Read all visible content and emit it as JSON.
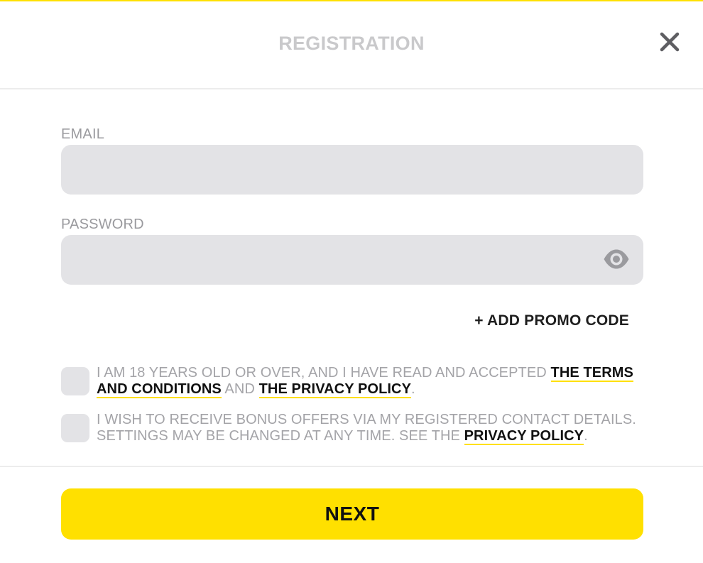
{
  "header": {
    "title": "REGISTRATION",
    "close_icon": "close-icon"
  },
  "form": {
    "email": {
      "label": "EMAIL",
      "value": "",
      "placeholder": ""
    },
    "password": {
      "label": "PASSWORD",
      "value": "",
      "placeholder": "",
      "toggle_icon": "eye-icon"
    },
    "promo_link": "+ ADD PROMO CODE"
  },
  "consents": {
    "age": {
      "checked": false,
      "text_before": "I AM 18 YEARS OLD OR OVER, AND I HAVE READ AND ACCEPTED ",
      "terms_link": "THE TERMS AND CONDITIONS",
      "text_between": " AND ",
      "privacy_link": "THE PRIVACY POLICY",
      "text_after": "."
    },
    "bonus": {
      "checked": false,
      "text_before": "I WISH TO RECEIVE BONUS OFFERS VIA MY REGISTERED CONTACT DETAILS. SETTINGS MAY BE CHANGED AT ANY TIME. SEE THE ",
      "privacy_link": "PRIVACY POLICY",
      "text_after": "."
    }
  },
  "footer": {
    "next_label": "NEXT"
  },
  "colors": {
    "accent": "#ffe000",
    "field_bg": "#e3e3e6",
    "muted_text": "#a4a4a8"
  }
}
